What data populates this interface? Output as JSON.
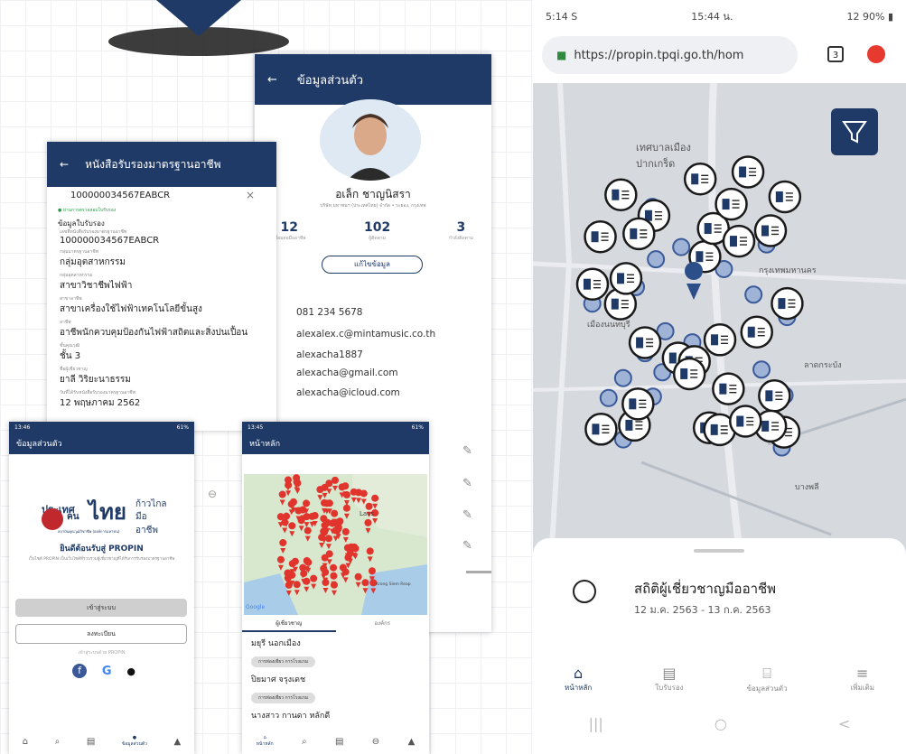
{
  "profile": {
    "title": "ข้อมูลส่วนตัว",
    "name": "อเล็ก ชาญนิสรา",
    "subtitle": "บริษัท มหาชนฯ (ประเทศไทย) จำกัด • ระยอง, กรุงเทพ",
    "stats": [
      {
        "value": "12",
        "label": "เชื่อมต่อมืออาชีพ"
      },
      {
        "value": "102",
        "label": "ผู้ติดตาม"
      },
      {
        "value": "3",
        "label": "กำลังติดตาม"
      }
    ],
    "edit_label": "แก้ไขข้อมูล",
    "contacts": [
      "081 234 5678",
      "alexalex.c@mintamusic.co.th",
      "alexacha1887",
      "alexacha@gmail.com",
      "alexacha@icloud.com"
    ]
  },
  "certificate": {
    "title": "หนังสือรับรองมาตรฐานอาชีพ",
    "cert_number": "100000034567EABCR",
    "verified_text": "ผ่านการตรวจสอบใบรับรอง",
    "section_title": "ข้อมูลใบรับรอง",
    "fields": [
      {
        "label": "เลขที่หนังสือรับรองมาตรฐานอาชีพ",
        "value": "100000034567EABCR"
      },
      {
        "label": "กลุ่มมาตรฐานอาชีพ",
        "value": "กลุ่มอุตสาหกรรม"
      },
      {
        "label": "กลุ่มอุตสาหกรรม",
        "value": "สาขาวิชาชีพไฟฟ้า"
      },
      {
        "label": "สาขาอาชีพ",
        "value": "สาขาเครื่องใช้ไฟฟ้าเทคโนโลยีขั้นสูง"
      },
      {
        "label": "อาชีพ",
        "value": "อาชีพนักควบคุมป้องกันไฟฟ้าสถิตและสิ่งปนเปื้อน"
      },
      {
        "label": "ชั้นคุณวุฒิ",
        "value": "ชั้น 3"
      },
      {
        "label": "ชื่อผู้เชี่ยวชาญ",
        "value": "ยาลี วิริยะนาธรรม"
      },
      {
        "label": "วันที่ได้รับหนังสือรับรองมาตรฐานอาชีพ",
        "value": "12 พฤษภาคม 2562"
      }
    ]
  },
  "welcome": {
    "status_time": "13:46",
    "status_right": "61%",
    "title": "ข้อมูลส่วนตัว",
    "logo_text_1": "ประเทศ",
    "logo_text_2": "ไทย",
    "logo_text_3": "ก้าวไกล",
    "logo_text_4": "มืออาชีพ",
    "logo_text_5": "คน",
    "org": "สถาบันคุณวุฒิวิชาชีพ (องค์การมหาชน)",
    "heading": "ยินดีต้อนรับสู่ PROPIN",
    "desc": "เว็บไซต์ PROPIN เป็นเว็บไซต์ที่รวบรวมผู้เชี่ยวชาญที่ได้รับการรับรองมาตรฐานอาชีพ",
    "login_label": "เข้าสู่ระบบ",
    "register_label": "ลงทะเบียน",
    "or_label": "เข้าสู่ระบบด้วย PROPIN",
    "nav_active": "ข้อมูลส่วนตัว"
  },
  "home": {
    "status_time": "13:45",
    "status_right": "61%",
    "title": "หน้าหลัก",
    "map_label_laos": "Laos",
    "map_label_google": "Google",
    "map_label_krong": "Krong Siem Reap",
    "tabs": [
      "ผู้เชี่ยวชาญ",
      "องค์กร"
    ],
    "people": [
      {
        "name": "มยุรี นอกเมือง",
        "chip": "การท่องเที่ยว การโรงแรม"
      },
      {
        "name": "ปิยมาศ จรุงเดช",
        "chip": "การท่องเที่ยว การโรงแรม"
      },
      {
        "name": "นางสาว กานดา หลักดี",
        "chip": ""
      }
    ],
    "nav_active": "หน้าหลัก"
  },
  "bigphone": {
    "status_left": "5:14 S",
    "status_center": "15:44 น.",
    "status_right": "12 90% ▮",
    "url": "https://propin.tpqi.go.th/hom",
    "tab_count": "3",
    "map_labels": [
      "เทศบาลเมืองปากเกร็ด",
      "เมืองนนทบุรี",
      "กรุงเทพมหานคร",
      "ลาดกระบัง",
      "บางพลี"
    ],
    "stats_title": "สถิติผู้เชี่ยวชาญมืออาชีพ",
    "stats_range": "12 ม.ค. 2563 - 13 ก.ค. 2563",
    "nav": [
      "หน้าหลัก",
      "ใบรับรอง",
      "ข้อมูลส่วนตัว",
      "เพิ่มเติม"
    ]
  }
}
